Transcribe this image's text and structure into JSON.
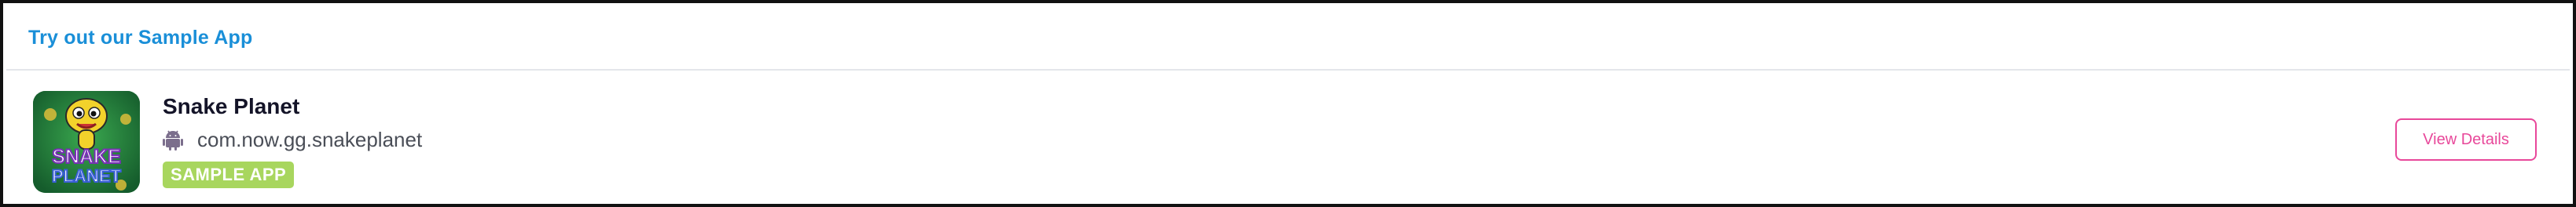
{
  "header": {
    "title": "Try out our Sample App"
  },
  "app": {
    "name": "Snake Planet",
    "package": "com.now.gg.snakeplanet",
    "badge": "SAMPLE APP",
    "platform_icon": "android-icon",
    "logo_text": [
      "SNAKE",
      "PLANET"
    ]
  },
  "actions": {
    "view_details_label": "View Details"
  },
  "colors": {
    "header_title": "#1a8fd8",
    "badge_bg": "#a8d65e",
    "button_accent": "#e8489a",
    "border": "#111111"
  }
}
